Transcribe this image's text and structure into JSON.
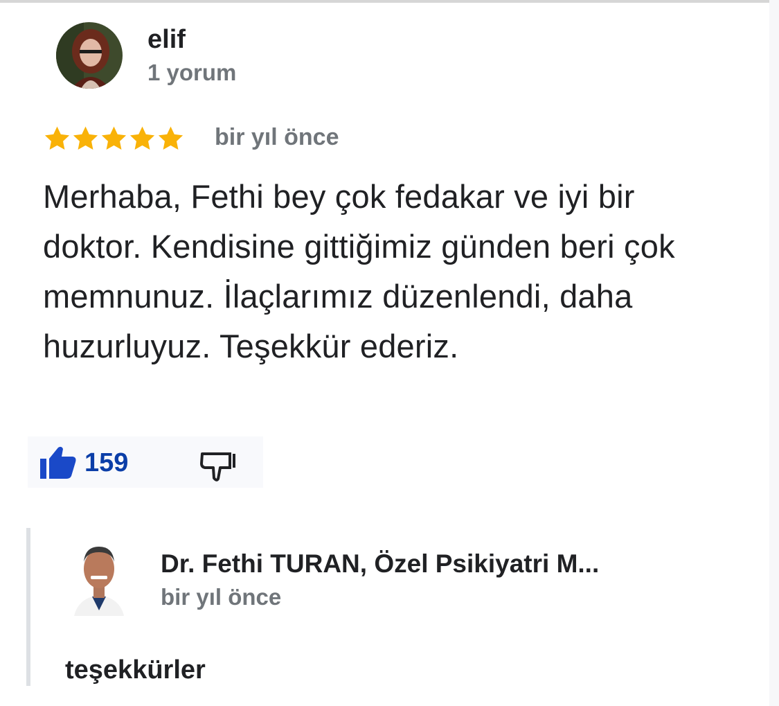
{
  "review": {
    "reviewer_name": "elif",
    "reviewer_meta": "1 yorum",
    "rating": 5,
    "rating_max": 5,
    "time": "bir yıl önce",
    "text": "Merhaba, Fethi bey çok fedakar ve iyi bir doktor. Kendisine gittiğimiz günden beri çok memnunuz. İlaçlarımız düzenlendi, daha huzurluyuz. Teşekkür ederiz.",
    "likes": "159"
  },
  "reply": {
    "owner_name": "Dr. Fethi TURAN, Özel Psikiyatri M...",
    "time": "bir yıl önce",
    "text": "teşekkürler"
  },
  "icons": {
    "star": "star-icon",
    "like": "thumb-up-icon",
    "dislike": "thumb-down-icon"
  },
  "colors": {
    "star": "#f9b208",
    "like": "#1a49c8",
    "like_count": "#0b3ea8",
    "primary_text": "#202124",
    "secondary_text": "#70757a",
    "reply_bar": "#dde0e4"
  }
}
